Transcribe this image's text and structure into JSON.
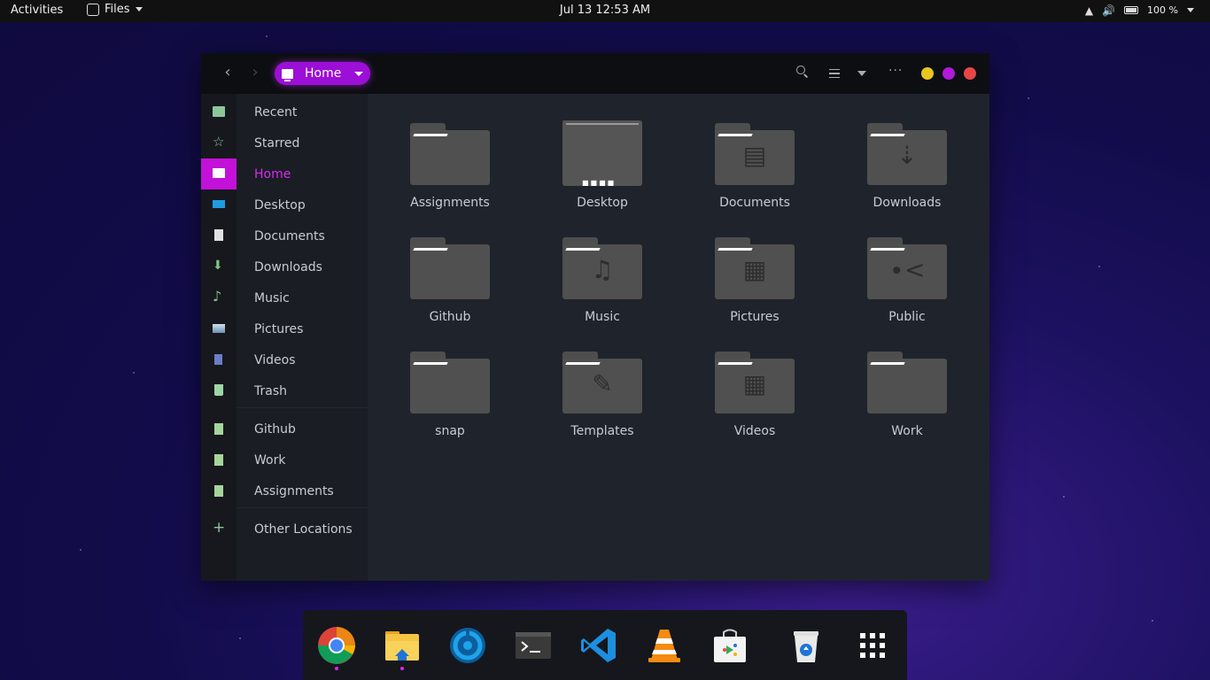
{
  "topbar": {
    "activities": "Activities",
    "app_menu": "Files",
    "clock": "Jul 13  12:53 AM",
    "battery": "100 %"
  },
  "window": {
    "path_label": "Home",
    "controls_colors": {
      "minimize": "#e8c51d",
      "maximize": "#b01ad9",
      "close": "#e84646"
    }
  },
  "sidebar": {
    "items": [
      {
        "label": "Recent",
        "icon": "folder-recent-icon",
        "color": "#8dc59a"
      },
      {
        "label": "Starred",
        "icon": "star-icon",
        "color": "#8dc59a"
      },
      {
        "label": "Home",
        "icon": "computer-icon",
        "color": "#ffffff",
        "active": true
      },
      {
        "label": "Desktop",
        "icon": "desktop-icon",
        "color": "#1e9be0"
      },
      {
        "label": "Documents",
        "icon": "document-icon",
        "color": "#e0e0e0"
      },
      {
        "label": "Downloads",
        "icon": "download-icon",
        "color": "#7fc47f"
      },
      {
        "label": "Music",
        "icon": "music-icon",
        "color": "#7fc47f"
      },
      {
        "label": "Pictures",
        "icon": "pictures-icon",
        "color": "#8fb7d6"
      },
      {
        "label": "Videos",
        "icon": "video-icon",
        "color": "#6a7ec7"
      },
      {
        "label": "Trash",
        "icon": "trash-icon",
        "color": "#9fd5a4"
      },
      {
        "label": "Github",
        "icon": "bookmark-icon",
        "color": "#a6d49a"
      },
      {
        "label": "Work",
        "icon": "bookmark-icon",
        "color": "#a6d49a"
      },
      {
        "label": "Assignments",
        "icon": "bookmark-icon",
        "color": "#a6d49a"
      },
      {
        "label": "Other Locations",
        "icon": "plus-icon",
        "color": "#8dc59a"
      }
    ]
  },
  "folders": [
    {
      "name": "Assignments",
      "emblem": ""
    },
    {
      "name": "Desktop",
      "emblem": "desktop"
    },
    {
      "name": "Documents",
      "emblem": "document"
    },
    {
      "name": "Downloads",
      "emblem": "download"
    },
    {
      "name": "Github",
      "emblem": ""
    },
    {
      "name": "Music",
      "emblem": "music"
    },
    {
      "name": "Pictures",
      "emblem": "picture"
    },
    {
      "name": "Public",
      "emblem": "share"
    },
    {
      "name": "snap",
      "emblem": ""
    },
    {
      "name": "Templates",
      "emblem": "template"
    },
    {
      "name": "Videos",
      "emblem": "video"
    },
    {
      "name": "Work",
      "emblem": ""
    }
  ],
  "dock": {
    "items": [
      {
        "name": "chrome-icon",
        "running": true
      },
      {
        "name": "files-icon",
        "running": true
      },
      {
        "name": "disk-usage-icon",
        "running": false
      },
      {
        "name": "terminal-icon",
        "running": false
      },
      {
        "name": "vscode-icon",
        "running": false
      },
      {
        "name": "vlc-icon",
        "running": false
      },
      {
        "name": "software-store-icon",
        "running": false
      },
      {
        "name": "recycle-bin-icon",
        "running": false
      },
      {
        "name": "app-grid-icon",
        "running": false
      }
    ]
  }
}
